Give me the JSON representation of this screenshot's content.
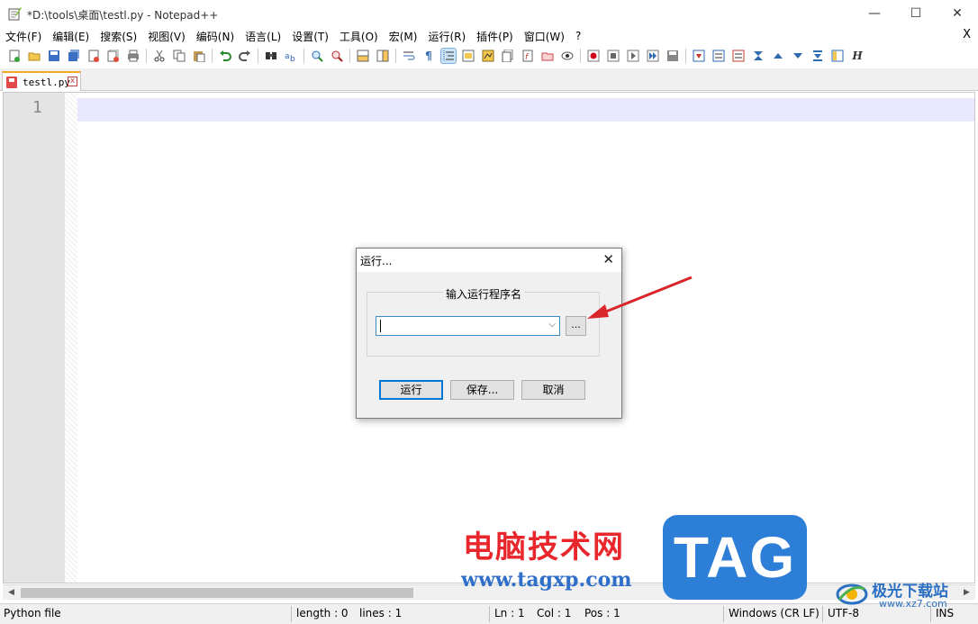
{
  "window": {
    "title": "*D:\\tools\\桌面\\testl.py - Notepad++",
    "minimize_glyph": "—",
    "maximize_glyph": "☐",
    "close_glyph": "✕"
  },
  "menu": {
    "items": [
      "文件(F)",
      "编辑(E)",
      "搜索(S)",
      "视图(V)",
      "编码(N)",
      "语言(L)",
      "设置(T)",
      "工具(O)",
      "宏(M)",
      "运行(R)",
      "插件(P)",
      "窗口(W)",
      "?"
    ],
    "close_label": "X"
  },
  "toolbar": {
    "icons": [
      "new-file-icon",
      "open-file-icon",
      "save-icon",
      "save-all-icon",
      "close-icon",
      "close-all-icon",
      "print-icon",
      "cut-icon",
      "copy-icon",
      "paste-icon",
      "undo-icon",
      "redo-icon",
      "find-icon",
      "replace-icon",
      "zoom-in-icon",
      "zoom-out-icon",
      "sync-v-icon",
      "sync-h-icon",
      "word-wrap-icon",
      "show-all-chars-icon",
      "indent-guide-icon",
      "udl-icon",
      "doc-map-icon",
      "doc-list-icon",
      "function-list-icon",
      "folder-workspace-icon",
      "monitor-icon",
      "record-macro-icon",
      "stop-macro-icon",
      "play-macro-icon",
      "run-macro-multiple-icon",
      "save-macro-icon",
      "lang-icon"
    ]
  },
  "tab": {
    "label": "testl.py",
    "close_glyph": "x"
  },
  "editor": {
    "line_numbers": [
      "1"
    ]
  },
  "dialog": {
    "title": "运行...",
    "close_glyph": "✕",
    "group_label": "输入运行程序名",
    "input_value": "",
    "dropdown_glyph": "⌵",
    "browse_label": "...",
    "run_label": "运行",
    "save_label": "保存...",
    "cancel_label": "取消"
  },
  "statusbar": {
    "file_type": "Python file",
    "length": "length : 0",
    "lines": "lines : 1",
    "ln": "Ln : 1",
    "col": "Col : 1",
    "pos": "Pos : 1",
    "eol": "Windows (CR LF)",
    "encoding": "UTF-8",
    "mode": "INS"
  },
  "watermark": {
    "site_cn": "电脑技术网",
    "site_url": "www.tagxp.com",
    "tag": "TAG",
    "logo_cn": "极光下载站",
    "logo_url": "www.xz7.com"
  },
  "colors": {
    "current_line": "#e8e8ff",
    "tab_accent": "#f5a623",
    "dialog_focus": "#0078d7",
    "arrow": "#d9262a"
  }
}
